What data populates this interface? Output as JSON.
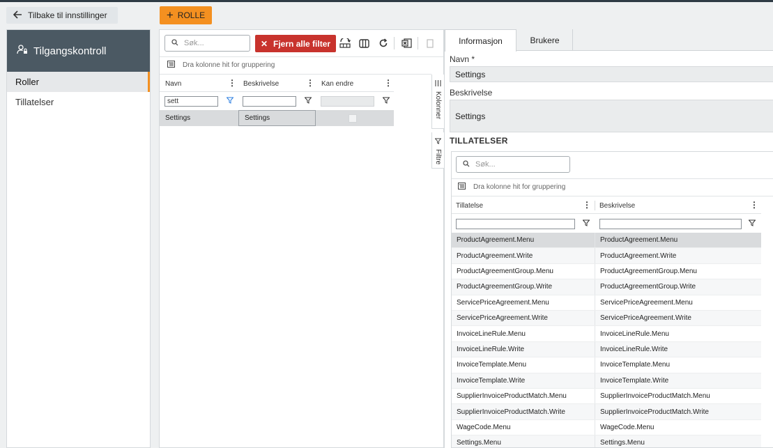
{
  "header": {
    "back_label": "Tilbake til innstillinger",
    "add_label": "ROLLE"
  },
  "leftnav": {
    "title": "Tilgangskontroll",
    "items": [
      {
        "label": "Roller",
        "active": true
      },
      {
        "label": "Tillatelser",
        "active": false
      }
    ]
  },
  "roles_grid": {
    "search_placeholder": "Søk...",
    "clear_filters_label": "Fjern alle filter",
    "group_hint": "Dra kolonne hit for gruppering",
    "columns": [
      "Navn",
      "Beskrivelse",
      "Kan endre"
    ],
    "filter_values": {
      "navn": "sett",
      "beskrivelse": ""
    },
    "rows": [
      {
        "navn": "Settings",
        "beskrivelse": "Settings",
        "kan_endre": false
      }
    ],
    "side_tabs": {
      "columns": "Kolonner",
      "filters": "Filtre"
    }
  },
  "detail": {
    "tabs": [
      {
        "label": "Informasjon",
        "active": true
      },
      {
        "label": "Brukere",
        "active": false
      }
    ],
    "name_label": "Navn *",
    "name_value": "Settings",
    "description_label": "Beskrivelse",
    "description_value": "Settings",
    "permissions_title": "TILLATELSER",
    "permissions": {
      "search_placeholder": "Søk...",
      "group_hint": "Dra kolonne hit for gruppering",
      "columns": [
        "Tillatelse",
        "Beskrivelse"
      ],
      "rows": [
        {
          "tillatelse": "ProductAgreement.Menu",
          "beskrivelse": "ProductAgreement.Menu"
        },
        {
          "tillatelse": "ProductAgreement.Write",
          "beskrivelse": "ProductAgreement.Write"
        },
        {
          "tillatelse": "ProductAgreementGroup.Menu",
          "beskrivelse": "ProductAgreementGroup.Menu"
        },
        {
          "tillatelse": "ProductAgreementGroup.Write",
          "beskrivelse": "ProductAgreementGroup.Write"
        },
        {
          "tillatelse": "ServicePriceAgreement.Menu",
          "beskrivelse": "ServicePriceAgreement.Menu"
        },
        {
          "tillatelse": "ServicePriceAgreement.Write",
          "beskrivelse": "ServicePriceAgreement.Write"
        },
        {
          "tillatelse": "InvoiceLineRule.Menu",
          "beskrivelse": "InvoiceLineRule.Menu"
        },
        {
          "tillatelse": "InvoiceLineRule.Write",
          "beskrivelse": "InvoiceLineRule.Write"
        },
        {
          "tillatelse": "InvoiceTemplate.Menu",
          "beskrivelse": "InvoiceTemplate.Menu"
        },
        {
          "tillatelse": "InvoiceTemplate.Write",
          "beskrivelse": "InvoiceTemplate.Write"
        },
        {
          "tillatelse": "SupplierInvoiceProductMatch.Menu",
          "beskrivelse": "SupplierInvoiceProductMatch.Menu"
        },
        {
          "tillatelse": "SupplierInvoiceProductMatch.Write",
          "beskrivelse": "SupplierInvoiceProductMatch.Write"
        },
        {
          "tillatelse": "WageCode.Menu",
          "beskrivelse": "WageCode.Menu"
        },
        {
          "tillatelse": "Settings.Menu",
          "beskrivelse": "Settings.Menu"
        }
      ]
    }
  },
  "colors": {
    "accent": "#f49020",
    "danger": "#c8332d",
    "nav_header": "#4b5963",
    "filter_icon": "#2a7de1"
  }
}
